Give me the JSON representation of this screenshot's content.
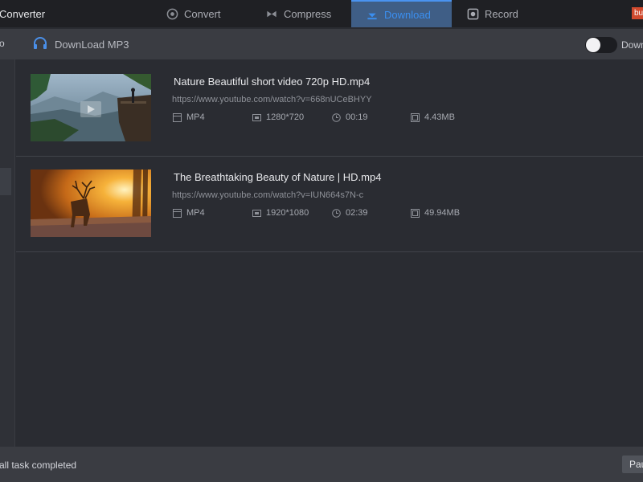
{
  "app": {
    "title": "Converter"
  },
  "tabs": [
    {
      "label": "Convert",
      "icon": "convert-icon"
    },
    {
      "label": "Compress",
      "icon": "compress-icon"
    },
    {
      "label": "Download",
      "icon": "download-icon",
      "active": true
    },
    {
      "label": "Record",
      "icon": "record-icon"
    }
  ],
  "buy_badge": "bu",
  "toolbar": {
    "left_fragment": "o",
    "download_mp3_label": "DownLoad MP3",
    "download_mp3_icon": "headphones-icon",
    "toggle_label": "Down",
    "toggle_on": false
  },
  "downloads": [
    {
      "name": "Nature Beautiful short video 720p HD.mp4",
      "url": "https://www.youtube.com/watch?v=668nUCeBHYY",
      "format": "MP4",
      "resolution": "1280*720",
      "duration": "00:19",
      "size": "4.43MB"
    },
    {
      "name": "The Breathtaking Beauty of Nature | HD.mp4",
      "url": "https://www.youtube.com/watch?v=IUN664s7N-c",
      "format": "MP4",
      "resolution": "1920*1080",
      "duration": "02:39",
      "size": "49.94MB"
    }
  ],
  "status": {
    "text": "all task completed",
    "pause_label": "Pau"
  },
  "colors": {
    "accent": "#3b8ff0",
    "active_tab_bg": "#3f5e86",
    "background": "#2a2c32",
    "badge": "#d14a2e"
  }
}
